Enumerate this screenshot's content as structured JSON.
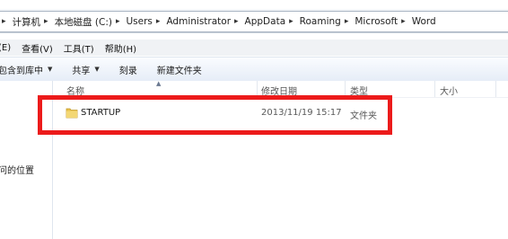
{
  "address_bar": {
    "crumbs": [
      "计算机",
      "本地磁盘 (C:)",
      "Users",
      "Administrator",
      "AppData",
      "Roaming",
      "Microsoft",
      "Word"
    ]
  },
  "menu": {
    "items": [
      "(E)",
      "查看(V)",
      "工具(T)",
      "帮助(H)"
    ]
  },
  "toolbar": {
    "include_library": "包含到库中",
    "share": "共享",
    "burn": "刻录",
    "new_folder": "新建文件夹"
  },
  "nav": {
    "recent_places": "问的位置"
  },
  "columns": {
    "name": "名称",
    "date": "修改日期",
    "type": "类型",
    "size": "大小"
  },
  "files": [
    {
      "name": "STARTUP",
      "date": "2013/11/19 15:17",
      "type": "文件夹",
      "size": ""
    }
  ],
  "colors": {
    "highlight_border": "#ec1b1b",
    "folder": "#e8c14a"
  },
  "icons": {
    "crumb_separator": "chevron-right-icon",
    "dropdown": "dropdown-arrow-icon",
    "folder": "folder-icon",
    "sort": "sort-ascending-icon"
  }
}
